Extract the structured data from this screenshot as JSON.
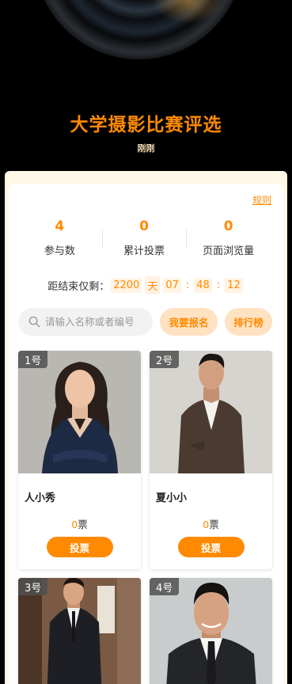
{
  "header": {
    "title": "大学摄影比赛评选",
    "subtitle": "刚刚"
  },
  "rules_label": "规则",
  "stats": [
    {
      "value": "4",
      "label": "参与数"
    },
    {
      "value": "0",
      "label": "累计投票"
    },
    {
      "value": "0",
      "label": "页面浏览量"
    }
  ],
  "countdown": {
    "prefix": "距结束仅剩：",
    "days": "2200",
    "day_unit": "天",
    "hours": "07",
    "minutes": "48",
    "seconds": "12",
    "sep": ":"
  },
  "search": {
    "placeholder": "请输入名称或者编号"
  },
  "buttons": {
    "signup": "我要报名",
    "ranking": "排行榜"
  },
  "entries": [
    {
      "badge": "1号",
      "name": "人小秀",
      "votes": "0",
      "vote_unit": "票",
      "vote_label": "投票"
    },
    {
      "badge": "2号",
      "name": "夏小小",
      "votes": "0",
      "vote_unit": "票",
      "vote_label": "投票"
    },
    {
      "badge": "3号"
    },
    {
      "badge": "4号"
    }
  ],
  "colors": {
    "accent": "#ff8a00",
    "accent_light": "#ffe2c2",
    "frame": "#fff8e6"
  },
  "icons": {
    "search": "search-icon"
  }
}
